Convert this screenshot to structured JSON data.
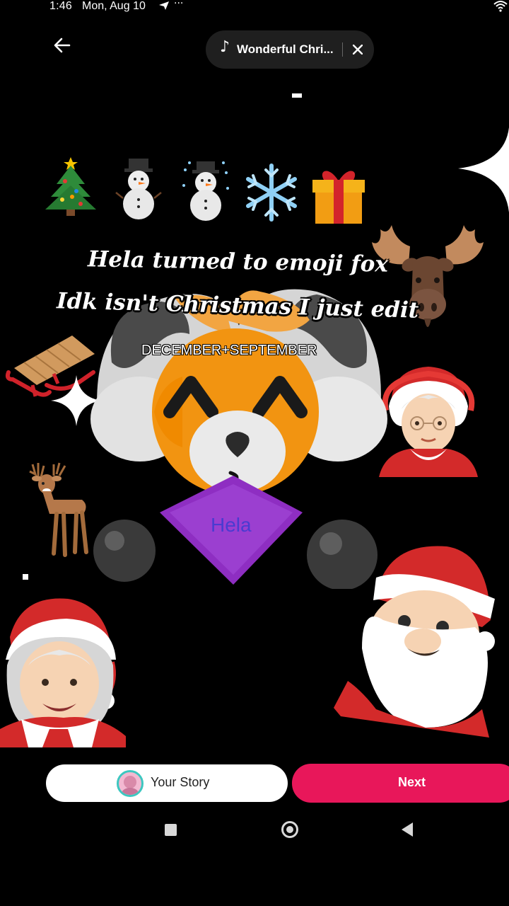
{
  "status_bar": {
    "time": "1:46",
    "date": "Mon, Aug 10",
    "more": "···"
  },
  "music": {
    "note": "♪",
    "title": "Wonderful Chri...",
    "close": "✕"
  },
  "captions": {
    "line1": "Hela turned to emoji fox",
    "line2": "Idk isn't Christmas I just edit",
    "line3": "DECEMBER+SEPTEMBER"
  },
  "character": {
    "name": "Hela"
  },
  "bottom": {
    "your_story": "Your Story",
    "next": "Next"
  },
  "colors": {
    "accent": "#e8175a",
    "story_ring": "#3dc7c0",
    "fox_orange": "#f29411",
    "diamond_purple": "#8e2ec2"
  },
  "icons": [
    "back-arrow-icon",
    "music-note-icon",
    "close-icon",
    "wifi-icon",
    "send-icon",
    "christmas-tree-icon",
    "snowman-icon",
    "snowflake-icon",
    "gift-icon",
    "moose-icon",
    "sled-icon",
    "sparkle-icon",
    "mrs-claus-icon",
    "deer-icon",
    "santa-icon"
  ]
}
